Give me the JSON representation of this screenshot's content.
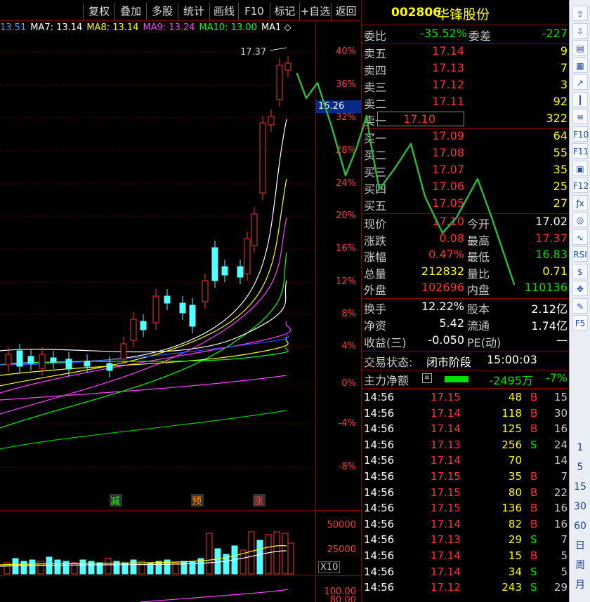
{
  "toolbar": {
    "buttons": [
      "复权",
      "叠加",
      "多股",
      "统计",
      "画线",
      "F10",
      "标记",
      "+自选",
      "返回"
    ]
  },
  "ma_legend": [
    {
      "label": "13.51",
      "color": "#3fa9ff"
    },
    {
      "label": "MA7: 13.14",
      "color": "#ffffff"
    },
    {
      "label": "MA8: 13.14",
      "color": "#ffff00"
    },
    {
      "label": "MA9: 13.24",
      "color": "#ff40ff"
    },
    {
      "label": "MA10: 13.00",
      "color": "#00ff00"
    },
    {
      "label": "MA1 ◇",
      "color": "#ffffff"
    }
  ],
  "chart": {
    "high_label": "17.37",
    "price_marker": "16.26",
    "markers": [
      {
        "label": "减",
        "color": "#00ff00"
      },
      {
        "label": "预",
        "color": "#ff8c00"
      },
      {
        "label": "涨",
        "color": "#ff4040"
      }
    ],
    "pct_axis": [
      "40%",
      "36%",
      "32%",
      "28%",
      "24%",
      "20%",
      "16%",
      "12%",
      "8%",
      "4%",
      "0%",
      "-4%",
      "-8%"
    ],
    "vol_axis": [
      "50000",
      "25000"
    ],
    "vol_unit": "X10",
    "ind_axis": [
      "100.00",
      "80.00"
    ]
  },
  "quote": {
    "code": "002806",
    "name": "华锋股份",
    "webi": {
      "k1": "委比",
      "v1": "-35.52%",
      "k2": "委差",
      "v2": "-227"
    },
    "asks": [
      {
        "label": "卖五",
        "price": "17.14",
        "vol": "9"
      },
      {
        "label": "卖四",
        "price": "17.13",
        "vol": "7"
      },
      {
        "label": "卖三",
        "price": "17.12",
        "vol": "3"
      },
      {
        "label": "卖二",
        "price": "17.11",
        "vol": "92"
      },
      {
        "label": "卖一",
        "price": "17.10",
        "vol": "322"
      }
    ],
    "bids": [
      {
        "label": "买一",
        "price": "17.09",
        "vol": "64"
      },
      {
        "label": "买二",
        "price": "17.08",
        "vol": "55"
      },
      {
        "label": "买三",
        "price": "17.07",
        "vol": "35"
      },
      {
        "label": "买四",
        "price": "17.06",
        "vol": "25"
      },
      {
        "label": "买五",
        "price": "17.05",
        "vol": "27"
      }
    ],
    "stats": [
      {
        "k1": "现价",
        "v1": "17.10",
        "c1": "red",
        "k2": "今开",
        "v2": "17.02",
        "c2": "wht"
      },
      {
        "k1": "涨跌",
        "v1": "0.08",
        "c1": "red",
        "k2": "最高",
        "v2": "17.37",
        "c2": "red"
      },
      {
        "k1": "涨幅",
        "v1": "0.47%",
        "c1": "red",
        "k2": "最低",
        "v2": "16.83",
        "c2": "grn"
      },
      {
        "k1": "总量",
        "v1": "212832",
        "c1": "yel",
        "k2": "量比",
        "v2": "0.71",
        "c2": "yel"
      },
      {
        "k1": "外盘",
        "v1": "102696",
        "c1": "red",
        "k2": "内盘",
        "v2": "110136",
        "c2": "grn"
      }
    ],
    "fund": [
      {
        "k1": "换手",
        "v1": "12.22%",
        "k2": "股本",
        "v2": "2.12亿"
      },
      {
        "k1": "净资",
        "v1": "5.42",
        "k2": "流通",
        "v2": "1.74亿"
      },
      {
        "k1": "收益(三)",
        "v1": "-0.050",
        "k2": "PE(动)",
        "v2": "—"
      }
    ],
    "status": {
      "label": "交易状态:",
      "value": "闭市阶段",
      "time": "15:00:03"
    },
    "main_flow": {
      "label": "主力净额",
      "value": "-2495万",
      "pct": "-7%"
    }
  },
  "ticks": [
    {
      "t": "14:56",
      "p": "17.15",
      "v": "48",
      "s": "B",
      "n": "15"
    },
    {
      "t": "14:56",
      "p": "17.14",
      "v": "118",
      "s": "B",
      "n": "30"
    },
    {
      "t": "14:56",
      "p": "17.14",
      "v": "125",
      "s": "B",
      "n": "16"
    },
    {
      "t": "14:56",
      "p": "17.13",
      "v": "256",
      "s": "S",
      "n": "24"
    },
    {
      "t": "14:56",
      "p": "17.14",
      "v": "70",
      "s": "",
      "n": "14"
    },
    {
      "t": "14:56",
      "p": "17.15",
      "v": "35",
      "s": "B",
      "n": "7"
    },
    {
      "t": "14:56",
      "p": "17.15",
      "v": "80",
      "s": "B",
      "n": "22"
    },
    {
      "t": "14:56",
      "p": "17.15",
      "v": "136",
      "s": "B",
      "n": "16"
    },
    {
      "t": "14:56",
      "p": "17.14",
      "v": "82",
      "s": "B",
      "n": "16"
    },
    {
      "t": "14:56",
      "p": "17.13",
      "v": "29",
      "s": "S",
      "n": "7"
    },
    {
      "t": "14:56",
      "p": "17.14",
      "v": "15",
      "s": "B",
      "n": "5"
    },
    {
      "t": "14:56",
      "p": "17.14",
      "v": "34",
      "s": "S",
      "n": "5"
    },
    {
      "t": "14:56",
      "p": "17.12",
      "v": "243",
      "s": "S",
      "n": "29"
    }
  ],
  "side_icons": [
    {
      "name": "up-arrow-icon",
      "glyph": "⇧"
    },
    {
      "name": "down-arrow-icon",
      "glyph": "⇩"
    },
    {
      "name": "tick-chart-icon",
      "glyph": "▤"
    },
    {
      "name": "table-icon",
      "glyph": "▦"
    },
    {
      "name": "trend-icon",
      "glyph": "↗"
    },
    {
      "name": "kline-icon",
      "glyph": "┃"
    },
    {
      "name": "f10-list-icon",
      "glyph": "≡"
    },
    {
      "name": "f10-icon",
      "glyph": "F10"
    },
    {
      "name": "f11-icon",
      "glyph": "F11"
    },
    {
      "name": "note-icon",
      "glyph": "▣"
    },
    {
      "name": "f12-icon",
      "glyph": "F12"
    },
    {
      "name": "fx-icon",
      "glyph": "ƒx"
    },
    {
      "name": "circle-icon",
      "glyph": "◎"
    },
    {
      "name": "wave-icon",
      "glyph": "∿"
    },
    {
      "name": "rsi-icon",
      "glyph": "RSI"
    },
    {
      "name": "dollar-icon",
      "glyph": "$"
    },
    {
      "name": "move-icon",
      "glyph": "✥"
    },
    {
      "name": "pencil-icon",
      "glyph": "✎"
    },
    {
      "name": "f5-icon",
      "glyph": "F5"
    }
  ],
  "period_buttons": [
    "1",
    "5",
    "15",
    "30",
    "60",
    "日",
    "周",
    "月"
  ]
}
